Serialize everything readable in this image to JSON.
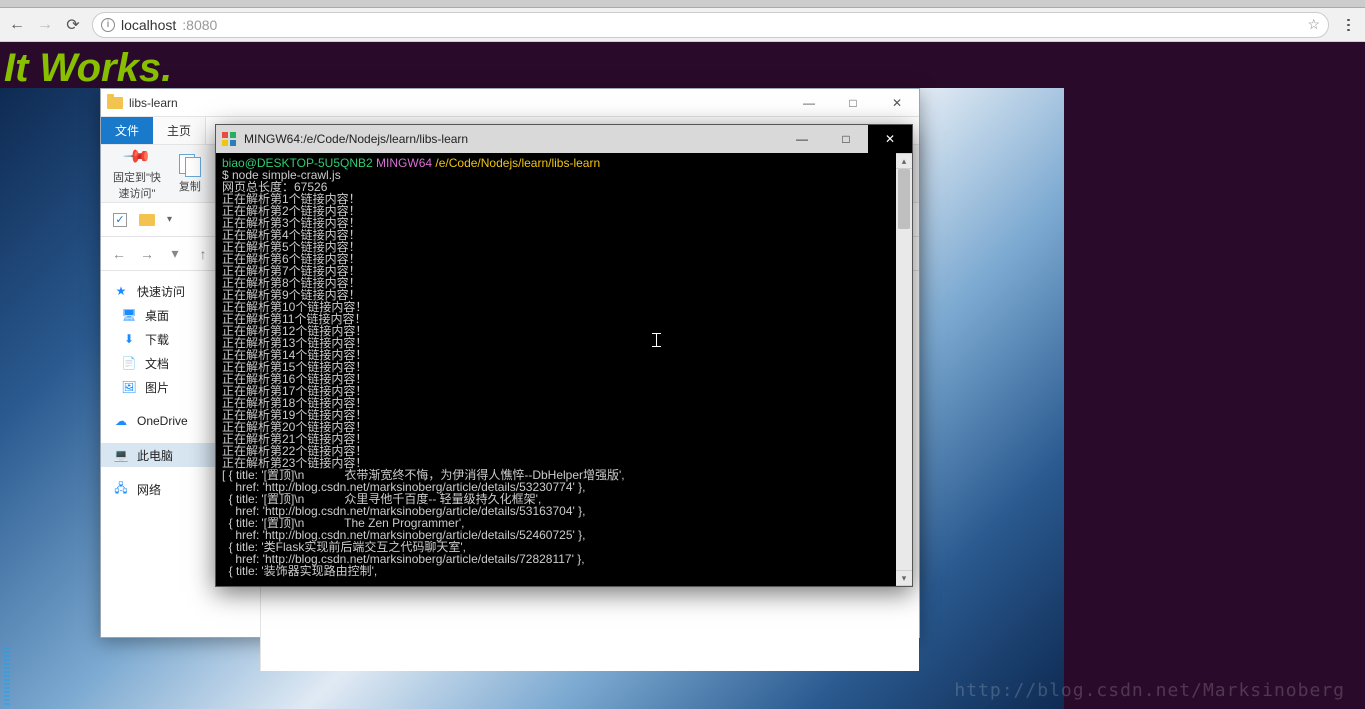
{
  "browser": {
    "url_host": "localhost",
    "url_port": ":8080"
  },
  "page": {
    "heading": "It Works.",
    "watermark": "http://blog.csdn.net/Marksinoberg"
  },
  "explorer": {
    "title": "libs-learn",
    "tabs": {
      "file": "文件",
      "home": "主页"
    },
    "quick": {
      "pin": "固定到\"快\n速访问\"",
      "copy": "复制"
    },
    "winbtns": {
      "min": "—",
      "max": "□",
      "close": "✕"
    },
    "side": {
      "quick_access": "快速访问",
      "desktop": "桌面",
      "downloads": "下载",
      "documents": "文档",
      "pictures": "图片",
      "onedrive": "OneDrive",
      "this_pc": "此电脑",
      "network": "网络"
    }
  },
  "terminal": {
    "title": "MINGW64:/e/Code/Nodejs/learn/libs-learn",
    "winbtns": {
      "min": "—",
      "max": "□",
      "close": "✕"
    },
    "prompt_user": "biao@DESKTOP-5U5QNB2",
    "prompt_env": "MINGW64",
    "prompt_path": "/e/Code/Nodejs/learn/libs-learn",
    "cmd": "$ node simple-crawl.js",
    "len_line": "网页总长度：67526",
    "parse_prefix": "正在解析第",
    "parse_suffix": "个链接内容！",
    "parse_count": 23,
    "results": [
      "[ { title: '[置顶]\\n            衣带渐宽终不悔，为伊消得人憔悴--DbHelper增强版',",
      "    href: 'http://blog.csdn.net/marksinoberg/article/details/53230774' },",
      "  { title: '[置顶]\\n            众里寻他千百度-- 轻量级持久化框架',",
      "    href: 'http://blog.csdn.net/marksinoberg/article/details/53163704' },",
      "  { title: '[置顶]\\n            The Zen Programmer',",
      "    href: 'http://blog.csdn.net/marksinoberg/article/details/52460725' },",
      "  { title: '类Flask实现前后端交互之代码聊天室',",
      "    href: 'http://blog.csdn.net/marksinoberg/article/details/72828117' },",
      "  { title: '装饰器实现路由控制',"
    ]
  }
}
